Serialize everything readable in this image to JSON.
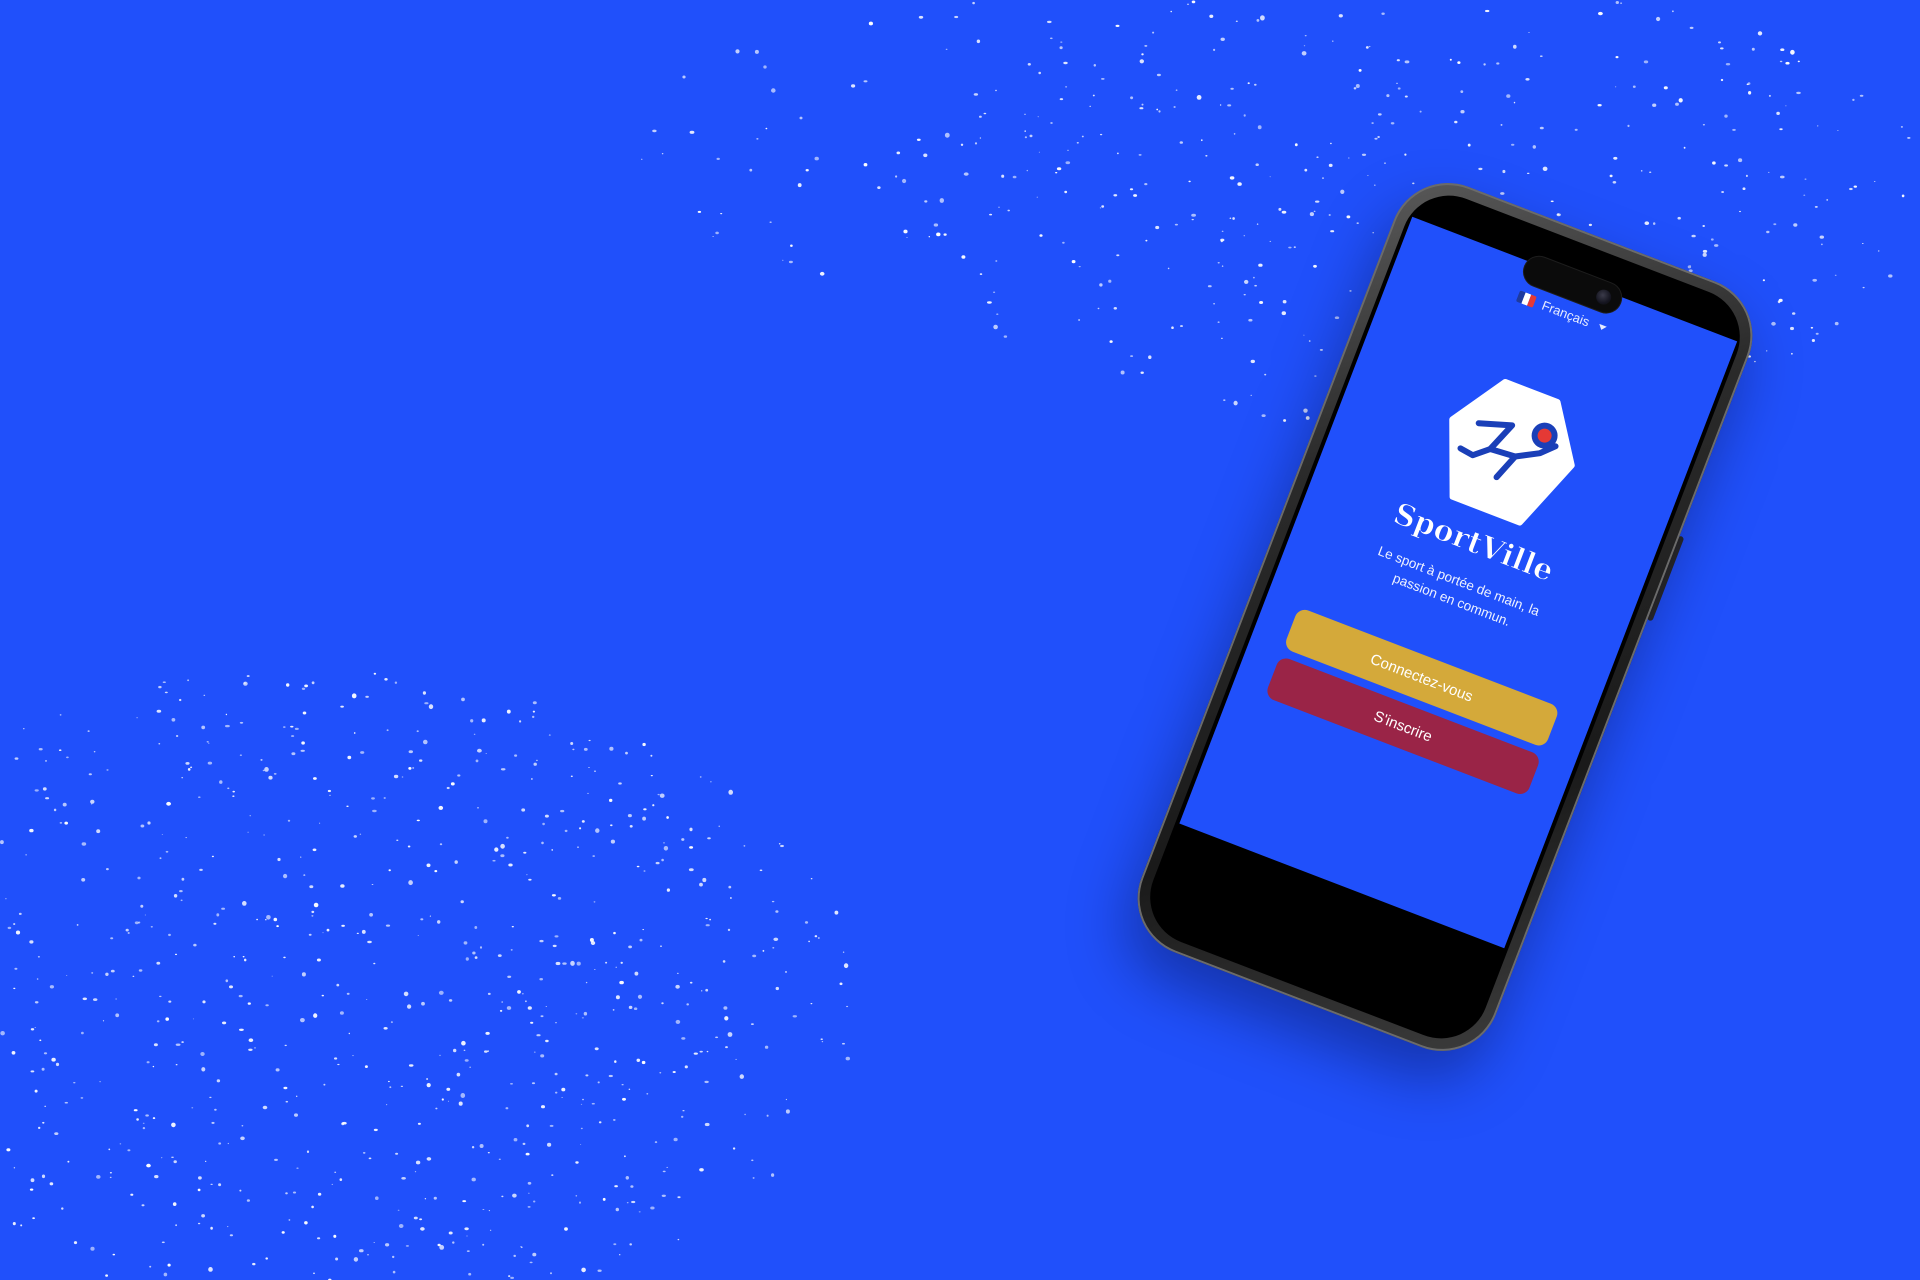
{
  "app": {
    "name": "SportVille",
    "tagline": "Le sport à portée de main, la passion en commun."
  },
  "language": {
    "selected": "Français",
    "flag_icon": "france-flag-icon",
    "dropdown_icon": "caret-down-icon"
  },
  "buttons": {
    "login_label": "Connectez-vous",
    "signup_label": "S'inscrire"
  },
  "colors": {
    "background": "#2050fb",
    "login_button": "#d4a93a",
    "signup_button": "#9a2447",
    "logo_figure": "#1a3fb8",
    "logo_dot": "#e53935"
  }
}
